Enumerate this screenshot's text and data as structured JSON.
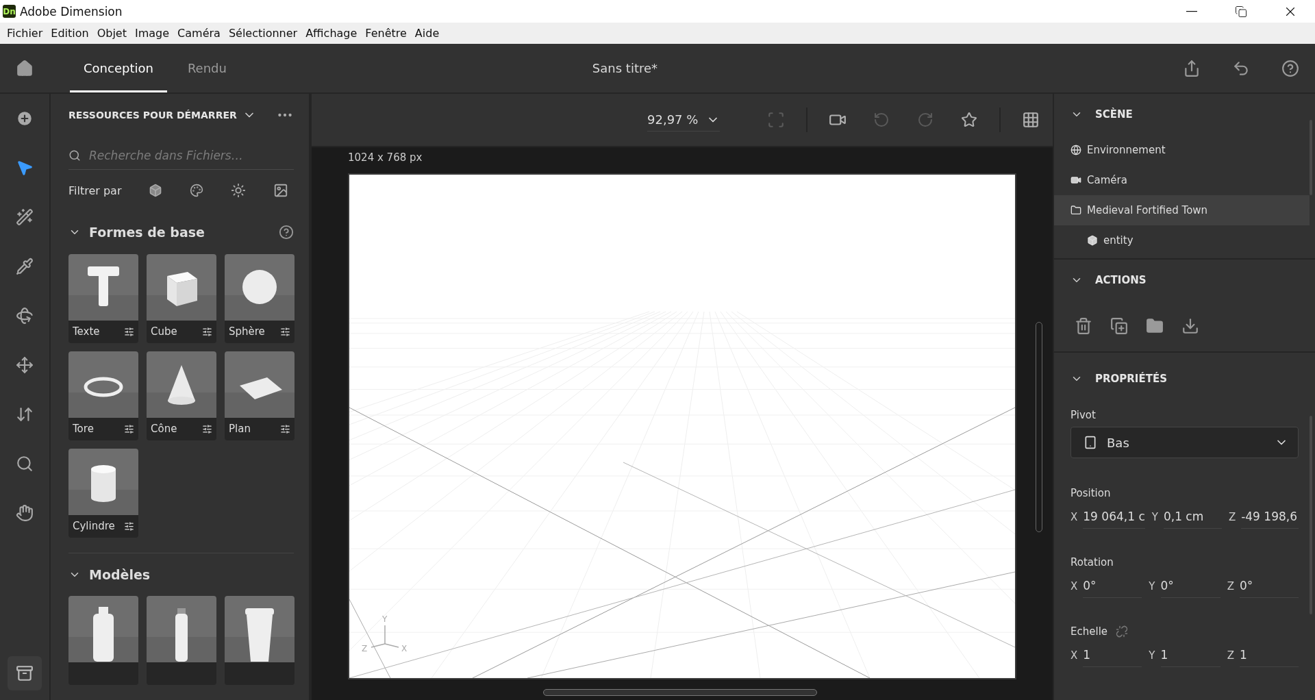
{
  "window": {
    "title": "Adobe Dimension",
    "logo": "Dn"
  },
  "menu": [
    "Fichier",
    "Edition",
    "Objet",
    "Image",
    "Caméra",
    "Sélectionner",
    "Affichage",
    "Fenêtre",
    "Aide"
  ],
  "header": {
    "tabs": [
      {
        "label": "Conception",
        "selected": true
      },
      {
        "label": "Rendu",
        "selected": false
      }
    ],
    "document_title": "Sans titre*"
  },
  "tools": [
    {
      "kind": "add",
      "selected": false
    },
    {
      "kind": "select",
      "selected": true
    },
    {
      "kind": "magic",
      "selected": false
    },
    {
      "kind": "sample",
      "selected": false
    },
    {
      "kind": "orbit",
      "selected": false
    },
    {
      "kind": "pan",
      "selected": false
    },
    {
      "kind": "dolly",
      "selected": false
    },
    {
      "kind": "zoom",
      "selected": false
    },
    {
      "kind": "hand",
      "selected": false
    }
  ],
  "assets": {
    "title": "RESSOURCES POUR DÉMARRER",
    "search": {
      "placeholder": "Recherche dans Fichiers…"
    },
    "filter_label": "Filtrer par",
    "sections": [
      {
        "title": "Formes de base",
        "expanded": true,
        "items": [
          {
            "label": "Texte",
            "kind": "text"
          },
          {
            "label": "Cube",
            "kind": "cube"
          },
          {
            "label": "Sphère",
            "kind": "sphere"
          },
          {
            "label": "Tore",
            "kind": "torus"
          },
          {
            "label": "Cône",
            "kind": "cone"
          },
          {
            "label": "Plan",
            "kind": "plane"
          },
          {
            "label": "Cylindre",
            "kind": "cylinder"
          }
        ]
      },
      {
        "title": "Modèles",
        "expanded": true,
        "items": [
          {
            "kind": "bottle"
          },
          {
            "kind": "tube"
          },
          {
            "kind": "cup"
          }
        ]
      }
    ]
  },
  "viewport": {
    "zoom": "92,97 %",
    "canvas_size": "1024 x 768 px",
    "axes": [
      "Y",
      "Z",
      "X"
    ]
  },
  "scene": {
    "title": "SCÈNE",
    "items": [
      {
        "label": "Environnement",
        "kind": "environment",
        "selected": false
      },
      {
        "label": "Caméra",
        "kind": "camera",
        "selected": false
      },
      {
        "label": "Medieval Fortified Town",
        "kind": "folder",
        "selected": true,
        "children": [
          {
            "label": "entity",
            "kind": "model",
            "selected": false
          }
        ]
      }
    ]
  },
  "actions": {
    "title": "ACTIONS"
  },
  "properties": {
    "title": "PROPRIÉTÉS",
    "pivot": {
      "label": "Pivot",
      "value": "Bas"
    },
    "groups": [
      {
        "label": "Position",
        "fields": [
          {
            "axis": "X",
            "value": "19 064,1 c"
          },
          {
            "axis": "Y",
            "value": "0,1 cm"
          },
          {
            "axis": "Z",
            "value": "-49 198,6"
          }
        ]
      },
      {
        "label": "Rotation",
        "fields": [
          {
            "axis": "X",
            "value": "0°"
          },
          {
            "axis": "Y",
            "value": "0°"
          },
          {
            "axis": "Z",
            "value": "0°"
          }
        ]
      },
      {
        "label": "Echelle",
        "linked": false,
        "fields": [
          {
            "axis": "X",
            "value": "1"
          },
          {
            "axis": "Y",
            "value": "1"
          },
          {
            "axis": "Z",
            "value": "1"
          }
        ]
      }
    ]
  }
}
